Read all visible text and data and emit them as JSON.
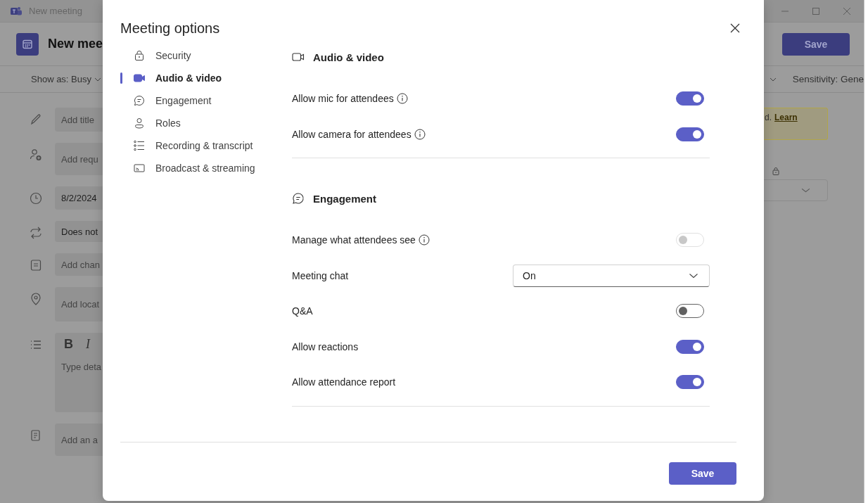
{
  "window": {
    "title": "New meeting"
  },
  "header": {
    "title": "New mee",
    "save_button": "Save"
  },
  "toolbar": {
    "show_as": "Show as: Busy",
    "sensitivity": "Sensitivity: Gene"
  },
  "form_fields": [
    {
      "kind": "title",
      "placeholder": "Add title"
    },
    {
      "kind": "attendees",
      "placeholder": "Add requ"
    },
    {
      "kind": "date",
      "value": "8/2/2024"
    },
    {
      "kind": "repeat",
      "value": "Does not"
    },
    {
      "kind": "channel",
      "placeholder": "Add chan"
    },
    {
      "kind": "location",
      "placeholder": "Add locat"
    },
    {
      "kind": "details",
      "placeholder": "Type deta",
      "tools": [
        {
          "kind": "bold",
          "label": "B"
        },
        {
          "kind": "italic",
          "label": "I"
        }
      ]
    },
    {
      "kind": "agenda",
      "placeholder": "Add an a"
    }
  ],
  "notice": {
    "text": "d.",
    "link": "Learn"
  },
  "dialog": {
    "title": "Meeting options",
    "nav": [
      {
        "kind": "security",
        "label": "Security",
        "selected": false
      },
      {
        "kind": "audio_video",
        "label": "Audio & video",
        "selected": true
      },
      {
        "kind": "engagement",
        "label": "Engagement",
        "selected": false
      },
      {
        "kind": "roles",
        "label": "Roles",
        "selected": false
      },
      {
        "kind": "recording",
        "label": "Recording & transcript",
        "selected": false
      },
      {
        "kind": "broadcast",
        "label": "Broadcast & streaming",
        "selected": false
      }
    ],
    "sections": [
      {
        "kind": "audio_video",
        "title": "Audio & video",
        "settings": [
          {
            "kind": "toggle",
            "label": "Allow mic for attendees",
            "info": true,
            "on": true,
            "disabled": false
          },
          {
            "kind": "toggle",
            "label": "Allow camera for attendees",
            "info": true,
            "on": true,
            "disabled": false
          }
        ]
      },
      {
        "kind": "engagement",
        "title": "Engagement",
        "settings": [
          {
            "kind": "toggle",
            "label": "Manage what attendees see",
            "info": true,
            "on": false,
            "disabled": true
          },
          {
            "kind": "dropdown",
            "label": "Meeting chat",
            "value": "On"
          },
          {
            "kind": "toggle",
            "label": "Q&A",
            "info": false,
            "on": false,
            "disabled": false
          },
          {
            "kind": "toggle",
            "label": "Allow reactions",
            "info": false,
            "on": true,
            "disabled": false
          },
          {
            "kind": "toggle",
            "label": "Allow attendance report",
            "info": false,
            "on": true,
            "disabled": false
          }
        ]
      }
    ],
    "save_button": "Save"
  }
}
